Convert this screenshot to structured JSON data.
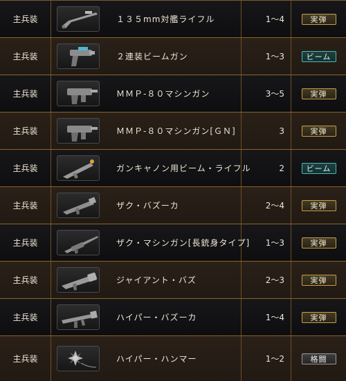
{
  "rows": [
    {
      "category": "主兵装",
      "weapon_icon": "rifle-icon",
      "name": "１３５mm対艦ライフル",
      "range": "1～4",
      "type": "実弾",
      "type_style": "live"
    },
    {
      "category": "主兵装",
      "weapon_icon": "beam-gun-icon",
      "name": "２連装ビームガン",
      "range": "1～3",
      "type": "ビーム",
      "type_style": "beam"
    },
    {
      "category": "主兵装",
      "weapon_icon": "machine-gun-icon",
      "name": "ＭＭＰ-８０マシンガン",
      "range": "3～5",
      "type": "実弾",
      "type_style": "live"
    },
    {
      "category": "主兵装",
      "weapon_icon": "machine-gun-icon",
      "name": "ＭＭＰ-８０マシンガン[ＧＮ]",
      "range": "3",
      "type": "実弾",
      "type_style": "live"
    },
    {
      "category": "主兵装",
      "weapon_icon": "beam-rifle-icon",
      "name": "ガンキャノン用ビーム・ライフル",
      "range": "2",
      "type": "ビーム",
      "type_style": "beam"
    },
    {
      "category": "主兵装",
      "weapon_icon": "bazooka-icon",
      "name": "ザク・バズーカ",
      "range": "2～4",
      "type": "実弾",
      "type_style": "live"
    },
    {
      "category": "主兵装",
      "weapon_icon": "long-machine-gun-icon",
      "name": "ザク・マシンガン[長銃身タイプ]",
      "range": "1～3",
      "type": "実弾",
      "type_style": "live"
    },
    {
      "category": "主兵装",
      "weapon_icon": "giant-bazooka-icon",
      "name": "ジャイアント・バズ",
      "range": "2～3",
      "type": "実弾",
      "type_style": "live"
    },
    {
      "category": "主兵装",
      "weapon_icon": "hyper-bazooka-icon",
      "name": "ハイパー・バズーカ",
      "range": "1～4",
      "type": "実弾",
      "type_style": "live"
    },
    {
      "category": "主兵装",
      "weapon_icon": "hammer-icon",
      "name": "ハイパー・ハンマー",
      "range": "1～2",
      "type": "格闘",
      "type_style": "melee"
    }
  ]
}
